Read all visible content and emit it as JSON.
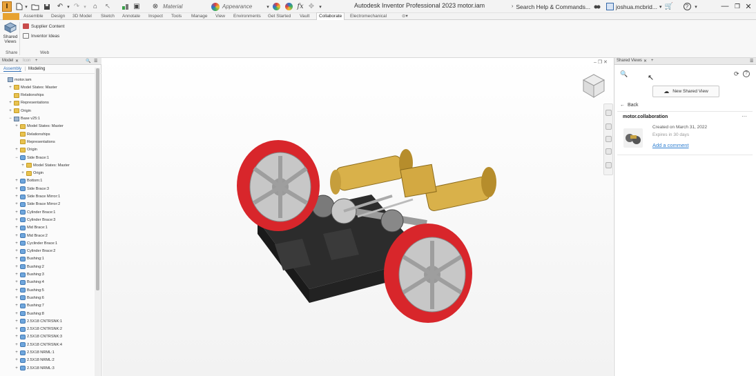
{
  "app": {
    "logo_letter": "I",
    "title": "Autodesk Inventor Professional 2023   motor.iam"
  },
  "quick_access": {
    "material": "Material",
    "appearance": "Appearance",
    "fx": "fx"
  },
  "search": {
    "label": "Search Help & Commands..."
  },
  "user": {
    "name": "joshua.mcbrid..."
  },
  "ribbon_tabs": [
    "Assemble",
    "Design",
    "3D Model",
    "Sketch",
    "Annotate",
    "Inspect",
    "Tools",
    "Manage",
    "View",
    "Environments",
    "Get Started",
    "Vault",
    "Collaborate",
    "Electromechanical"
  ],
  "ribbon_active_tab": "Collaborate",
  "ribbon": {
    "shared_views_label": "Shared Views",
    "supplier_content": "Supplier Content",
    "inventor_ideas": "Inventor Ideas",
    "group_share": "Share",
    "group_web": "Web"
  },
  "browser": {
    "tab_model": "Model",
    "tab_icon": "Icon",
    "subtab_assembly": "Assembly",
    "subtab_modeling": "Modeling",
    "items": [
      {
        "label": "motor.iam",
        "icon": "asm",
        "indent": 0,
        "expander": ""
      },
      {
        "label": "Model States: Master",
        "icon": "folder",
        "indent": 1,
        "expander": "+"
      },
      {
        "label": "Relationships",
        "icon": "folder",
        "indent": 1,
        "expander": ""
      },
      {
        "label": "Representations",
        "icon": "folder",
        "indent": 1,
        "expander": "+"
      },
      {
        "label": "Origin",
        "icon": "folder",
        "indent": 1,
        "expander": "+"
      },
      {
        "label": "Base v25:1",
        "icon": "asm",
        "indent": 1,
        "expander": "−"
      },
      {
        "label": "Model States: Master",
        "icon": "folder",
        "indent": 2,
        "expander": "+"
      },
      {
        "label": "Relationships",
        "icon": "folder",
        "indent": 2,
        "expander": ""
      },
      {
        "label": "Representations",
        "icon": "folder",
        "indent": 2,
        "expander": ""
      },
      {
        "label": "Origin",
        "icon": "folder",
        "indent": 2,
        "expander": "+"
      },
      {
        "label": "Side Brace:1",
        "icon": "part",
        "indent": 2,
        "expander": "−"
      },
      {
        "label": "Model States: Master",
        "icon": "folder",
        "indent": 3,
        "expander": "+"
      },
      {
        "label": "Origin",
        "icon": "folder",
        "indent": 3,
        "expander": "+"
      },
      {
        "label": "Bottom:1",
        "icon": "part",
        "indent": 2,
        "expander": "+"
      },
      {
        "label": "Side Brace:3",
        "icon": "part",
        "indent": 2,
        "expander": "+"
      },
      {
        "label": "Side Brace Mirror:1",
        "icon": "part",
        "indent": 2,
        "expander": "+"
      },
      {
        "label": "Side Brace Mirror:2",
        "icon": "part",
        "indent": 2,
        "expander": "+"
      },
      {
        "label": "Cylinder Brace:1",
        "icon": "part",
        "indent": 2,
        "expander": "+"
      },
      {
        "label": "Cylinder Brace:3",
        "icon": "part",
        "indent": 2,
        "expander": "+"
      },
      {
        "label": "Mid Brace:1",
        "icon": "part",
        "indent": 2,
        "expander": "+"
      },
      {
        "label": "Mid Brace:2",
        "icon": "part",
        "indent": 2,
        "expander": "+"
      },
      {
        "label": "Cyclinder Brace:1",
        "icon": "part",
        "indent": 2,
        "expander": "+"
      },
      {
        "label": "Cylinder Brace:2",
        "icon": "part",
        "indent": 2,
        "expander": "+"
      },
      {
        "label": "Bushing:1",
        "icon": "part",
        "indent": 2,
        "expander": "+"
      },
      {
        "label": "Bushing:2",
        "icon": "part",
        "indent": 2,
        "expander": "+"
      },
      {
        "label": "Bushing:3",
        "icon": "part",
        "indent": 2,
        "expander": "+"
      },
      {
        "label": "Bushing:4",
        "icon": "part",
        "indent": 2,
        "expander": "+"
      },
      {
        "label": "Bushing:5",
        "icon": "part",
        "indent": 2,
        "expander": "+"
      },
      {
        "label": "Bushing:6",
        "icon": "part",
        "indent": 2,
        "expander": "+"
      },
      {
        "label": "Bushing:7",
        "icon": "part",
        "indent": 2,
        "expander": "+"
      },
      {
        "label": "Bushing:8",
        "icon": "part",
        "indent": 2,
        "expander": "+"
      },
      {
        "label": "2.5X18 CNTRSNK:1",
        "icon": "part",
        "indent": 2,
        "expander": "+"
      },
      {
        "label": "2.5X18 CNTRSNK:2",
        "icon": "part",
        "indent": 2,
        "expander": "+"
      },
      {
        "label": "2.5X18 CNTRSNK:3",
        "icon": "part",
        "indent": 2,
        "expander": "+"
      },
      {
        "label": "2.5X18 CNTRSNK:4",
        "icon": "part",
        "indent": 2,
        "expander": "+"
      },
      {
        "label": "2.5X18 NRML:1",
        "icon": "part",
        "indent": 2,
        "expander": "+"
      },
      {
        "label": "2.5X18 NRML:2",
        "icon": "part",
        "indent": 2,
        "expander": "+"
      },
      {
        "label": "2.5X18 NRML:3",
        "icon": "part",
        "indent": 2,
        "expander": "+"
      }
    ]
  },
  "shared_views_panel": {
    "tab_label": "Shared Views",
    "new_shared_view": "New Shared View",
    "back": "Back",
    "view_name": "motor.collaboration",
    "created": "Created on March 31, 2022",
    "expires": "Expires in 30 days",
    "add_comment": "Add a comment"
  },
  "colors": {
    "file_tab": "#e7a230",
    "wheel_red": "#d8262b",
    "brass": "#d9b14a",
    "link_blue": "#2f7fd1"
  }
}
